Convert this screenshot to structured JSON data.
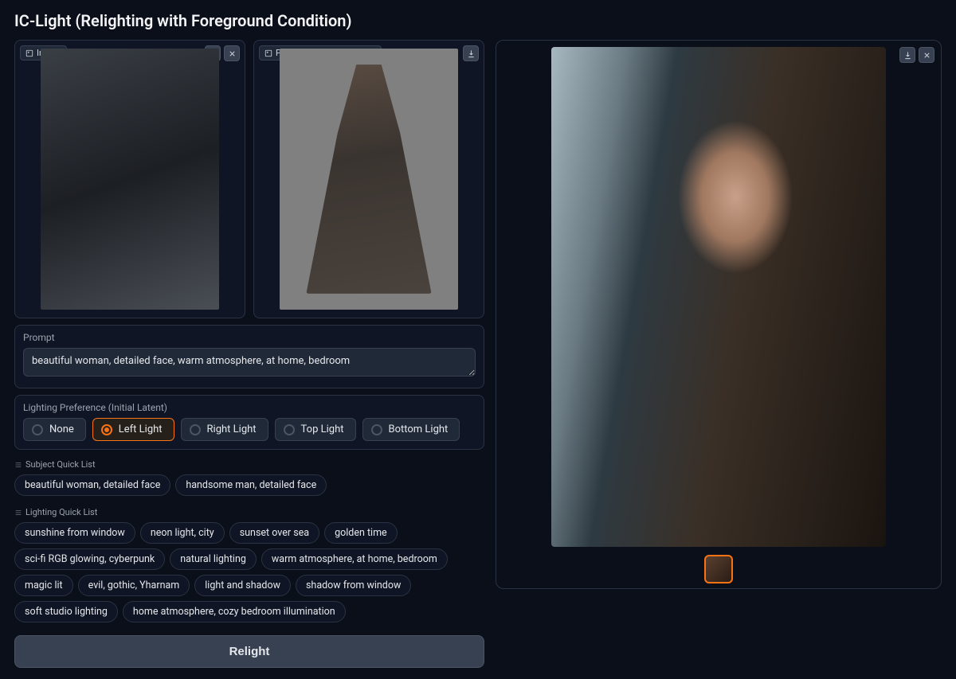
{
  "title": "IC-Light (Relighting with Foreground Condition)",
  "panels": {
    "input_label": "Image",
    "preprocessed_label": "Preprocessed Foreground"
  },
  "prompt": {
    "label": "Prompt",
    "value": "beautiful woman, detailed face, warm atmosphere, at home, bedroom"
  },
  "lighting": {
    "label": "Lighting Preference (Initial Latent)",
    "options": [
      "None",
      "Left Light",
      "Right Light",
      "Top Light",
      "Bottom Light"
    ],
    "selected": "Left Light"
  },
  "subject_quick": {
    "label": "Subject Quick List",
    "items": [
      "beautiful woman, detailed face",
      "handsome man, detailed face"
    ]
  },
  "lighting_quick": {
    "label": "Lighting Quick List",
    "items": [
      "sunshine from window",
      "neon light, city",
      "sunset over sea",
      "golden time",
      "sci-fi RGB glowing, cyberpunk",
      "natural lighting",
      "warm atmosphere, at home, bedroom",
      "magic lit",
      "evil, gothic, Yharnam",
      "light and shadow",
      "shadow from window",
      "soft studio lighting",
      "home atmosphere, cozy bedroom illumination"
    ]
  },
  "run_button": "Relight"
}
